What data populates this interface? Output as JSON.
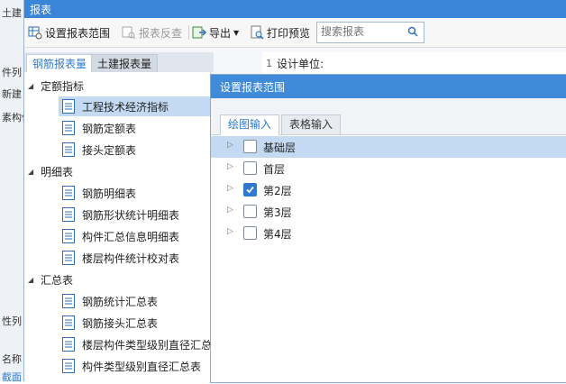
{
  "background_app": {
    "top_text": "土建",
    "side_texts": [
      "件列",
      "新建",
      "素构件",
      "性列",
      "名称",
      "截面"
    ]
  },
  "window": {
    "title": "报表"
  },
  "toolbar": {
    "set_range": "设置报表范围",
    "report_check": "报表反查",
    "export": "导出",
    "print_preview": "打印预览",
    "search_placeholder": "搜索报表"
  },
  "left_tabs": [
    "钢筋报表量",
    "土建报表量"
  ],
  "tree": {
    "groups": [
      {
        "label": "定额指标",
        "items": [
          "工程技术经济指标",
          "钢筋定额表",
          "接头定额表"
        ]
      },
      {
        "label": "明细表",
        "items": [
          "钢筋明细表",
          "钢筋形状统计明细表",
          "构件汇总信息明细表",
          "楼层构件统计校对表"
        ]
      },
      {
        "label": "汇总表",
        "items": [
          "钢筋统计汇总表",
          "钢筋接头汇总表",
          "楼层构件类型级别直径汇总",
          "构件类型级别直径汇总表"
        ]
      }
    ],
    "selected_item": "工程技术经济指标"
  },
  "preview": {
    "row_number": "1",
    "design_unit": "设计单位:"
  },
  "dialog": {
    "title": "设置报表范围",
    "tabs": [
      "绘图输入",
      "表格输入"
    ],
    "active_tab": "绘图输入",
    "floors": [
      {
        "label": "基础层",
        "checked": false,
        "selected": true
      },
      {
        "label": "首层",
        "checked": false,
        "selected": false
      },
      {
        "label": "第2层",
        "checked": true,
        "selected": false
      },
      {
        "label": "第3层",
        "checked": false,
        "selected": false
      },
      {
        "label": "第4层",
        "checked": false,
        "selected": false
      }
    ]
  },
  "colors": {
    "title_blue": "#3a85d8",
    "selection": "#c4d9f2",
    "accent": "#2f7ad0"
  }
}
